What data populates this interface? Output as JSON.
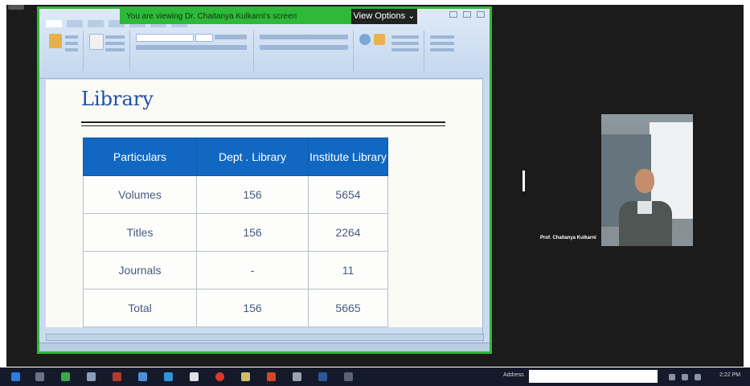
{
  "banner": {
    "viewing_text": "You are viewing Dr. Chaitanya Kulkarni's screen",
    "view_options_label": "View Options"
  },
  "slide": {
    "title": "Library",
    "table": {
      "headers": [
        "Particulars",
        "Dept . Library",
        "Institute Library"
      ],
      "rows": [
        [
          "Volumes",
          "156",
          "5654"
        ],
        [
          "Titles",
          "156",
          "2264"
        ],
        [
          "Journals",
          "-",
          "11"
        ],
        [
          "Total",
          "156",
          "5665"
        ]
      ]
    }
  },
  "video": {
    "participant_name": "Prof. Chaitanya Kulkarni"
  },
  "colors": {
    "share_border": "#2fb83a",
    "table_header": "#1168c2",
    "title": "#1f4fa8"
  },
  "icons": [
    "start-icon",
    "windows-explorer-icon",
    "chrome-icon",
    "powerpoint-icon",
    "word-icon"
  ]
}
